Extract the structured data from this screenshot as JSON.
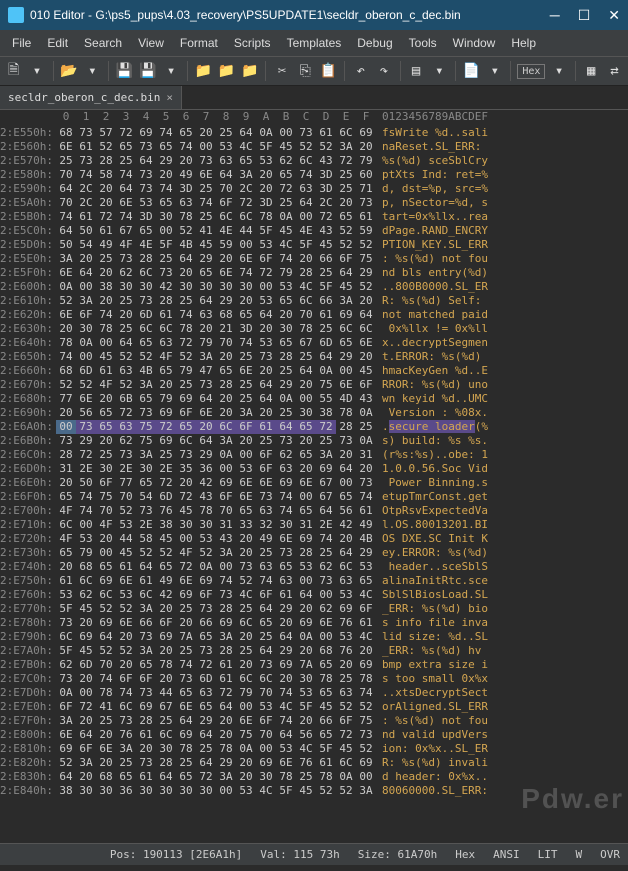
{
  "title": "010 Editor - G:\\ps5_pups\\4.03_recovery\\PS5UPDATE1\\secldr_oberon_c_dec.bin",
  "menus": [
    "File",
    "Edit",
    "Search",
    "View",
    "Format",
    "Scripts",
    "Templates",
    "Debug",
    "Tools",
    "Window",
    "Help"
  ],
  "toolbar_hex": "Hex",
  "tab_name": "secldr_oberon_c_dec.bin",
  "hex_cols": [
    "0",
    "1",
    "2",
    "3",
    "4",
    "5",
    "6",
    "7",
    "8",
    "9",
    "A",
    "B",
    "C",
    "D",
    "E",
    "F"
  ],
  "ascii_header": "0123456789ABCDEF",
  "highlight_row": 9,
  "highlight_start": 1,
  "highlight_end": 13,
  "rows": [
    {
      "a": "2:E550h:",
      "h": [
        "68",
        "73",
        "57",
        "72",
        "69",
        "74",
        "65",
        "20",
        "25",
        "64",
        "0A",
        "00",
        "73",
        "61",
        "6C",
        "69"
      ],
      "t": "fsWrite %d..sali"
    },
    {
      "a": "2:E560h:",
      "h": [
        "6E",
        "61",
        "52",
        "65",
        "73",
        "65",
        "74",
        "00",
        "53",
        "4C",
        "5F",
        "45",
        "52",
        "52",
        "3A",
        "20"
      ],
      "t": "naReset.SL_ERR: "
    },
    {
      "a": "2:E570h:",
      "h": [
        "25",
        "73",
        "28",
        "25",
        "64",
        "29",
        "20",
        "73",
        "63",
        "65",
        "53",
        "62",
        "6C",
        "43",
        "72",
        "79"
      ],
      "t": "%s(%d) sceSblCry"
    },
    {
      "a": "2:E580h:",
      "h": [
        "70",
        "74",
        "58",
        "74",
        "73",
        "20",
        "49",
        "6E",
        "64",
        "3A",
        "20",
        "65",
        "74",
        "3D",
        "25",
        "60"
      ],
      "t": "ptXts Ind: ret=%"
    },
    {
      "a": "2:E590h:",
      "h": [
        "64",
        "2C",
        "20",
        "64",
        "73",
        "74",
        "3D",
        "25",
        "70",
        "2C",
        "20",
        "72",
        "63",
        "3D",
        "25",
        "71"
      ],
      "t": "d, dst=%p, src=%"
    },
    {
      "a": "2:E5A0h:",
      "h": [
        "70",
        "2C",
        "20",
        "6E",
        "53",
        "65",
        "63",
        "74",
        "6F",
        "72",
        "3D",
        "25",
        "64",
        "2C",
        "20",
        "73"
      ],
      "t": "p, nSector=%d, s"
    },
    {
      "a": "2:E5B0h:",
      "h": [
        "74",
        "61",
        "72",
        "74",
        "3D",
        "30",
        "78",
        "25",
        "6C",
        "6C",
        "78",
        "0A",
        "00",
        "72",
        "65",
        "61"
      ],
      "t": "tart=0x%llx..rea"
    },
    {
      "a": "2:E5C0h:",
      "h": [
        "64",
        "50",
        "61",
        "67",
        "65",
        "00",
        "52",
        "41",
        "4E",
        "44",
        "5F",
        "45",
        "4E",
        "43",
        "52",
        "59"
      ],
      "t": "dPage.RAND_ENCRY"
    },
    {
      "a": "2:E5D0h:",
      "h": [
        "50",
        "54",
        "49",
        "4F",
        "4E",
        "5F",
        "4B",
        "45",
        "59",
        "00",
        "53",
        "4C",
        "5F",
        "45",
        "52",
        "52"
      ],
      "t": "PTION_KEY.SL_ERR"
    },
    {
      "a": "2:E5E0h:",
      "h": [
        "3A",
        "20",
        "25",
        "73",
        "28",
        "25",
        "64",
        "29",
        "20",
        "6E",
        "6F",
        "74",
        "20",
        "66",
        "6F",
        "75"
      ],
      "t": ": %s(%d) not fou"
    },
    {
      "a": "2:E5F0h:",
      "h": [
        "6E",
        "64",
        "20",
        "62",
        "6C",
        "73",
        "20",
        "65",
        "6E",
        "74",
        "72",
        "79",
        "28",
        "25",
        "64",
        "29"
      ],
      "t": "nd bls entry(%d)"
    },
    {
      "a": "2:E600h:",
      "h": [
        "0A",
        "00",
        "38",
        "30",
        "30",
        "42",
        "30",
        "30",
        "30",
        "30",
        "00",
        "53",
        "4C",
        "5F",
        "45",
        "52"
      ],
      "t": "..800B0000.SL_ER"
    },
    {
      "a": "2:E610h:",
      "h": [
        "52",
        "3A",
        "20",
        "25",
        "73",
        "28",
        "25",
        "64",
        "29",
        "20",
        "53",
        "65",
        "6C",
        "66",
        "3A",
        "20"
      ],
      "t": "R: %s(%d) Self: "
    },
    {
      "a": "2:E620h:",
      "h": [
        "6E",
        "6F",
        "74",
        "20",
        "6D",
        "61",
        "74",
        "63",
        "68",
        "65",
        "64",
        "20",
        "70",
        "61",
        "69",
        "64"
      ],
      "t": "not matched paid"
    },
    {
      "a": "2:E630h:",
      "h": [
        "20",
        "30",
        "78",
        "25",
        "6C",
        "6C",
        "78",
        "20",
        "21",
        "3D",
        "20",
        "30",
        "78",
        "25",
        "6C",
        "6C"
      ],
      "t": " 0x%llx != 0x%ll"
    },
    {
      "a": "2:E640h:",
      "h": [
        "78",
        "0A",
        "00",
        "64",
        "65",
        "63",
        "72",
        "79",
        "70",
        "74",
        "53",
        "65",
        "67",
        "6D",
        "65",
        "6E"
      ],
      "t": "x..decryptSegmen"
    },
    {
      "a": "2:E650h:",
      "h": [
        "74",
        "00",
        "45",
        "52",
        "52",
        "4F",
        "52",
        "3A",
        "20",
        "25",
        "73",
        "28",
        "25",
        "64",
        "29",
        "20"
      ],
      "t": "t.ERROR: %s(%d) "
    },
    {
      "a": "2:E660h:",
      "h": [
        "68",
        "6D",
        "61",
        "63",
        "4B",
        "65",
        "79",
        "47",
        "65",
        "6E",
        "20",
        "25",
        "64",
        "0A",
        "00",
        "45"
      ],
      "t": "hmacKeyGen %d..E"
    },
    {
      "a": "2:E670h:",
      "h": [
        "52",
        "52",
        "4F",
        "52",
        "3A",
        "20",
        "25",
        "73",
        "28",
        "25",
        "64",
        "29",
        "20",
        "75",
        "6E",
        "6F"
      ],
      "t": "RROR: %s(%d) uno"
    },
    {
      "a": "2:E680h:",
      "h": [
        "77",
        "6E",
        "20",
        "6B",
        "65",
        "79",
        "69",
        "64",
        "20",
        "25",
        "64",
        "0A",
        "00",
        "55",
        "4D",
        "43"
      ],
      "t": "wn keyid %d..UMC"
    },
    {
      "a": "2:E690h:",
      "h": [
        "20",
        "56",
        "65",
        "72",
        "73",
        "69",
        "6F",
        "6E",
        "20",
        "3A",
        "20",
        "25",
        "30",
        "38",
        "78",
        "0A"
      ],
      "t": " Version : %08x."
    },
    {
      "a": "2:E6A0h:",
      "h": [
        "00",
        "73",
        "65",
        "63",
        "75",
        "72",
        "65",
        "20",
        "6C",
        "6F",
        "61",
        "64",
        "65",
        "72",
        "28",
        "25"
      ],
      "t": ".secure loader(%"
    },
    {
      "a": "2:E6B0h:",
      "h": [
        "73",
        "29",
        "20",
        "62",
        "75",
        "69",
        "6C",
        "64",
        "3A",
        "20",
        "25",
        "73",
        "20",
        "25",
        "73",
        "0A"
      ],
      "t": "s) build: %s %s."
    },
    {
      "a": "2:E6C0h:",
      "h": [
        "28",
        "72",
        "25",
        "73",
        "3A",
        "25",
        "73",
        "29",
        "0A",
        "00",
        "6F",
        "62",
        "65",
        "3A",
        "20",
        "31"
      ],
      "t": "(r%s:%s)..obe: 1"
    },
    {
      "a": "2:E6D0h:",
      "h": [
        "31",
        "2E",
        "30",
        "2E",
        "30",
        "2E",
        "35",
        "36",
        "00",
        "53",
        "6F",
        "63",
        "20",
        "69",
        "64",
        "20"
      ],
      "t": "1.0.0.56.Soc Vid"
    },
    {
      "a": "2:E6E0h:",
      "h": [
        "20",
        "50",
        "6F",
        "77",
        "65",
        "72",
        "20",
        "42",
        "69",
        "6E",
        "6E",
        "69",
        "6E",
        "67",
        "00",
        "73"
      ],
      "t": " Power Binning.s"
    },
    {
      "a": "2:E6F0h:",
      "h": [
        "65",
        "74",
        "75",
        "70",
        "54",
        "6D",
        "72",
        "43",
        "6F",
        "6E",
        "73",
        "74",
        "00",
        "67",
        "65",
        "74"
      ],
      "t": "etupTmrConst.get"
    },
    {
      "a": "2:E700h:",
      "h": [
        "4F",
        "74",
        "70",
        "52",
        "73",
        "76",
        "45",
        "78",
        "70",
        "65",
        "63",
        "74",
        "65",
        "64",
        "56",
        "61"
      ],
      "t": "OtpRsvExpectedVa"
    },
    {
      "a": "2:E710h:",
      "h": [
        "6C",
        "00",
        "4F",
        "53",
        "2E",
        "38",
        "30",
        "30",
        "31",
        "33",
        "32",
        "30",
        "31",
        "2E",
        "42",
        "49"
      ],
      "t": "l.OS.80013201.BI"
    },
    {
      "a": "2:E720h:",
      "h": [
        "4F",
        "53",
        "20",
        "44",
        "58",
        "45",
        "00",
        "53",
        "43",
        "20",
        "49",
        "6E",
        "69",
        "74",
        "20",
        "4B"
      ],
      "t": "OS DXE.SC Init K"
    },
    {
      "a": "2:E730h:",
      "h": [
        "65",
        "79",
        "00",
        "45",
        "52",
        "52",
        "4F",
        "52",
        "3A",
        "20",
        "25",
        "73",
        "28",
        "25",
        "64",
        "29"
      ],
      "t": "ey.ERROR: %s(%d)"
    },
    {
      "a": "2:E740h:",
      "h": [
        "20",
        "68",
        "65",
        "61",
        "64",
        "65",
        "72",
        "0A",
        "00",
        "73",
        "63",
        "65",
        "53",
        "62",
        "6C",
        "53"
      ],
      "t": " header..sceSblS"
    },
    {
      "a": "2:E750h:",
      "h": [
        "61",
        "6C",
        "69",
        "6E",
        "61",
        "49",
        "6E",
        "69",
        "74",
        "52",
        "74",
        "63",
        "00",
        "73",
        "63",
        "65"
      ],
      "t": "alinaInitRtc.sce"
    },
    {
      "a": "2:E760h:",
      "h": [
        "53",
        "62",
        "6C",
        "53",
        "6C",
        "42",
        "69",
        "6F",
        "73",
        "4C",
        "6F",
        "61",
        "64",
        "00",
        "53",
        "4C"
      ],
      "t": "SblSlBiosLoad.SL"
    },
    {
      "a": "2:E770h:",
      "h": [
        "5F",
        "45",
        "52",
        "52",
        "3A",
        "20",
        "25",
        "73",
        "28",
        "25",
        "64",
        "29",
        "20",
        "62",
        "69",
        "6F"
      ],
      "t": "_ERR: %s(%d) bio"
    },
    {
      "a": "2:E780h:",
      "h": [
        "73",
        "20",
        "69",
        "6E",
        "66",
        "6F",
        "20",
        "66",
        "69",
        "6C",
        "65",
        "20",
        "69",
        "6E",
        "76",
        "61"
      ],
      "t": "s info file inva"
    },
    {
      "a": "2:E790h:",
      "h": [
        "6C",
        "69",
        "64",
        "20",
        "73",
        "69",
        "7A",
        "65",
        "3A",
        "20",
        "25",
        "64",
        "0A",
        "00",
        "53",
        "4C"
      ],
      "t": "lid size: %d..SL"
    },
    {
      "a": "2:E7A0h:",
      "h": [
        "5F",
        "45",
        "52",
        "52",
        "3A",
        "20",
        "25",
        "73",
        "28",
        "25",
        "64",
        "29",
        "20",
        "68",
        "76",
        "20"
      ],
      "t": "_ERR: %s(%d) hv "
    },
    {
      "a": "2:E7B0h:",
      "h": [
        "62",
        "6D",
        "70",
        "20",
        "65",
        "78",
        "74",
        "72",
        "61",
        "20",
        "73",
        "69",
        "7A",
        "65",
        "20",
        "69"
      ],
      "t": "bmp extra size i"
    },
    {
      "a": "2:E7C0h:",
      "h": [
        "73",
        "20",
        "74",
        "6F",
        "6F",
        "20",
        "73",
        "6D",
        "61",
        "6C",
        "6C",
        "20",
        "30",
        "78",
        "25",
        "78"
      ],
      "t": "s too small 0x%x"
    },
    {
      "a": "2:E7D0h:",
      "h": [
        "0A",
        "00",
        "78",
        "74",
        "73",
        "44",
        "65",
        "63",
        "72",
        "79",
        "70",
        "74",
        "53",
        "65",
        "63",
        "74"
      ],
      "t": "..xtsDecryptSect"
    },
    {
      "a": "2:E7E0h:",
      "h": [
        "6F",
        "72",
        "41",
        "6C",
        "69",
        "67",
        "6E",
        "65",
        "64",
        "00",
        "53",
        "4C",
        "5F",
        "45",
        "52",
        "52"
      ],
      "t": "orAligned.SL_ERR"
    },
    {
      "a": "2:E7F0h:",
      "h": [
        "3A",
        "20",
        "25",
        "73",
        "28",
        "25",
        "64",
        "29",
        "20",
        "6E",
        "6F",
        "74",
        "20",
        "66",
        "6F",
        "75"
      ],
      "t": ": %s(%d) not fou"
    },
    {
      "a": "2:E800h:",
      "h": [
        "6E",
        "64",
        "20",
        "76",
        "61",
        "6C",
        "69",
        "64",
        "20",
        "75",
        "70",
        "64",
        "56",
        "65",
        "72",
        "73"
      ],
      "t": "nd valid updVers"
    },
    {
      "a": "2:E810h:",
      "h": [
        "69",
        "6F",
        "6E",
        "3A",
        "20",
        "30",
        "78",
        "25",
        "78",
        "0A",
        "00",
        "53",
        "4C",
        "5F",
        "45",
        "52"
      ],
      "t": "ion: 0x%x..SL_ER"
    },
    {
      "a": "2:E820h:",
      "h": [
        "52",
        "3A",
        "20",
        "25",
        "73",
        "28",
        "25",
        "64",
        "29",
        "20",
        "69",
        "6E",
        "76",
        "61",
        "6C",
        "69"
      ],
      "t": "R: %s(%d) invali"
    },
    {
      "a": "2:E830h:",
      "h": [
        "64",
        "20",
        "68",
        "65",
        "61",
        "64",
        "65",
        "72",
        "3A",
        "20",
        "30",
        "78",
        "25",
        "78",
        "0A",
        "00"
      ],
      "t": "d header: 0x%x.."
    },
    {
      "a": "2:E840h:",
      "h": [
        "38",
        "30",
        "30",
        "36",
        "30",
        "30",
        "30",
        "30",
        "00",
        "53",
        "4C",
        "5F",
        "45",
        "52",
        "52",
        "3A"
      ],
      "t": "80060000.SL_ERR:"
    }
  ],
  "status": {
    "pos": "Pos: 190113 [2E6A1h]",
    "val": "Val: 115 73h",
    "size": "Size: 61A70h",
    "enc": "Hex",
    "ansi": "ANSI",
    "lit": "LIT",
    "w": "W",
    "ovr": "OVR"
  },
  "watermark": "Pdw.er",
  "chart_data": null
}
